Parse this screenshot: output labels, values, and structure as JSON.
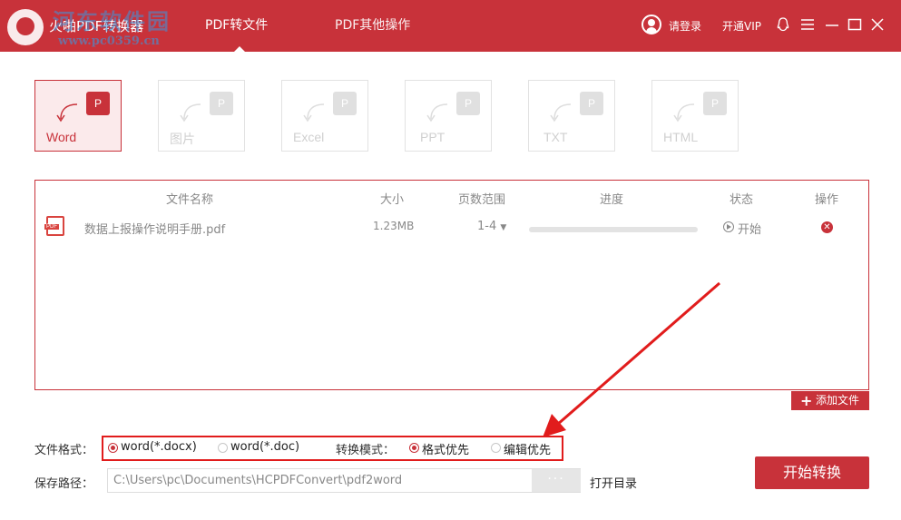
{
  "titlebar": {
    "app_title": "火啪PDF转换器",
    "watermark_line1": "河东软件园",
    "watermark_line2": "www.pc0359.cn",
    "tabs": [
      {
        "label": "PDF转文件",
        "active": true
      },
      {
        "label": "PDF其他操作",
        "active": false
      }
    ],
    "login_label": "请登录",
    "vip_label": "开通VIP",
    "accent_color": "#c8323a"
  },
  "formats": [
    {
      "label": "Word",
      "badge": "P",
      "active": true
    },
    {
      "label": "图片",
      "badge": "P",
      "active": false
    },
    {
      "label": "Excel",
      "badge": "P",
      "active": false
    },
    {
      "label": "PPT",
      "badge": "P",
      "active": false
    },
    {
      "label": "TXT",
      "badge": "P",
      "active": false
    },
    {
      "label": "HTML",
      "badge": "P",
      "active": false
    }
  ],
  "table": {
    "headers": {
      "name": "文件名称",
      "size": "大小",
      "pages": "页数范围",
      "progress": "进度",
      "status": "状态",
      "action": "操作"
    },
    "rows": [
      {
        "icon_label": "PDF",
        "name": "数据上报操作说明手册.pdf",
        "size": "1.23MB",
        "pages": "1-4",
        "progress": 0,
        "status": "开始"
      }
    ]
  },
  "add_file_label": "添加文件",
  "options": {
    "format_label": "文件格式：",
    "format_options": [
      {
        "label": "word(*.docx)",
        "selected": true
      },
      {
        "label": "word(*.doc)",
        "selected": false
      }
    ],
    "mode_label": "转换模式：",
    "mode_options": [
      {
        "label": "格式优先",
        "selected": true
      },
      {
        "label": "编辑优先",
        "selected": false
      }
    ],
    "path_label": "保存路径：",
    "path_value": "C:\\Users\\pc\\Documents\\HCPDFConvert\\pdf2word",
    "browse_label": "···",
    "open_dir_label": "打开目录",
    "start_label": "开始转换"
  }
}
